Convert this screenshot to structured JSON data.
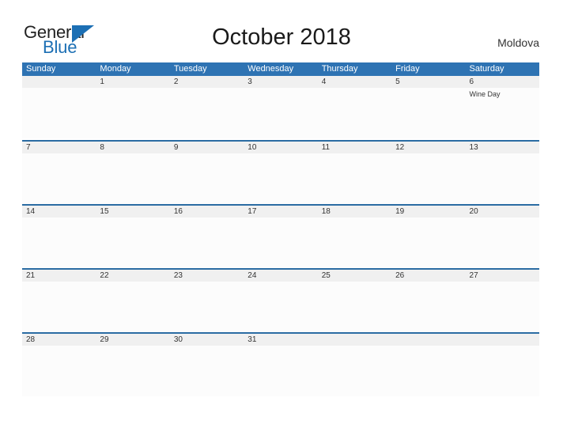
{
  "logo": {
    "word_top": "General",
    "word_bottom": "Blue",
    "accent_color": "#1c6fb4",
    "mark": "triangle-flag-icon"
  },
  "header": {
    "title": "October 2018",
    "region": "Moldova"
  },
  "theme": {
    "header_blue": "#2e73b3",
    "divider_blue": "#2b6ca3",
    "date_strip_gray": "#f0f0f0",
    "cell_white": "#fcfcfc",
    "text_dark": "#333333"
  },
  "calendar": {
    "month": "October",
    "year": "2018",
    "weekday_headers": [
      "Sunday",
      "Monday",
      "Tuesday",
      "Wednesday",
      "Thursday",
      "Friday",
      "Saturday"
    ],
    "weeks": [
      [
        {
          "date": "",
          "events": []
        },
        {
          "date": "1",
          "events": []
        },
        {
          "date": "2",
          "events": []
        },
        {
          "date": "3",
          "events": []
        },
        {
          "date": "4",
          "events": []
        },
        {
          "date": "5",
          "events": []
        },
        {
          "date": "6",
          "events": [
            "Wine Day"
          ]
        }
      ],
      [
        {
          "date": "7",
          "events": []
        },
        {
          "date": "8",
          "events": []
        },
        {
          "date": "9",
          "events": []
        },
        {
          "date": "10",
          "events": []
        },
        {
          "date": "11",
          "events": []
        },
        {
          "date": "12",
          "events": []
        },
        {
          "date": "13",
          "events": []
        }
      ],
      [
        {
          "date": "14",
          "events": []
        },
        {
          "date": "15",
          "events": []
        },
        {
          "date": "16",
          "events": []
        },
        {
          "date": "17",
          "events": []
        },
        {
          "date": "18",
          "events": []
        },
        {
          "date": "19",
          "events": []
        },
        {
          "date": "20",
          "events": []
        }
      ],
      [
        {
          "date": "21",
          "events": []
        },
        {
          "date": "22",
          "events": []
        },
        {
          "date": "23",
          "events": []
        },
        {
          "date": "24",
          "events": []
        },
        {
          "date": "25",
          "events": []
        },
        {
          "date": "26",
          "events": []
        },
        {
          "date": "27",
          "events": []
        }
      ],
      [
        {
          "date": "28",
          "events": []
        },
        {
          "date": "29",
          "events": []
        },
        {
          "date": "30",
          "events": []
        },
        {
          "date": "31",
          "events": []
        },
        {
          "date": "",
          "events": []
        },
        {
          "date": "",
          "events": []
        },
        {
          "date": "",
          "events": []
        }
      ]
    ]
  }
}
